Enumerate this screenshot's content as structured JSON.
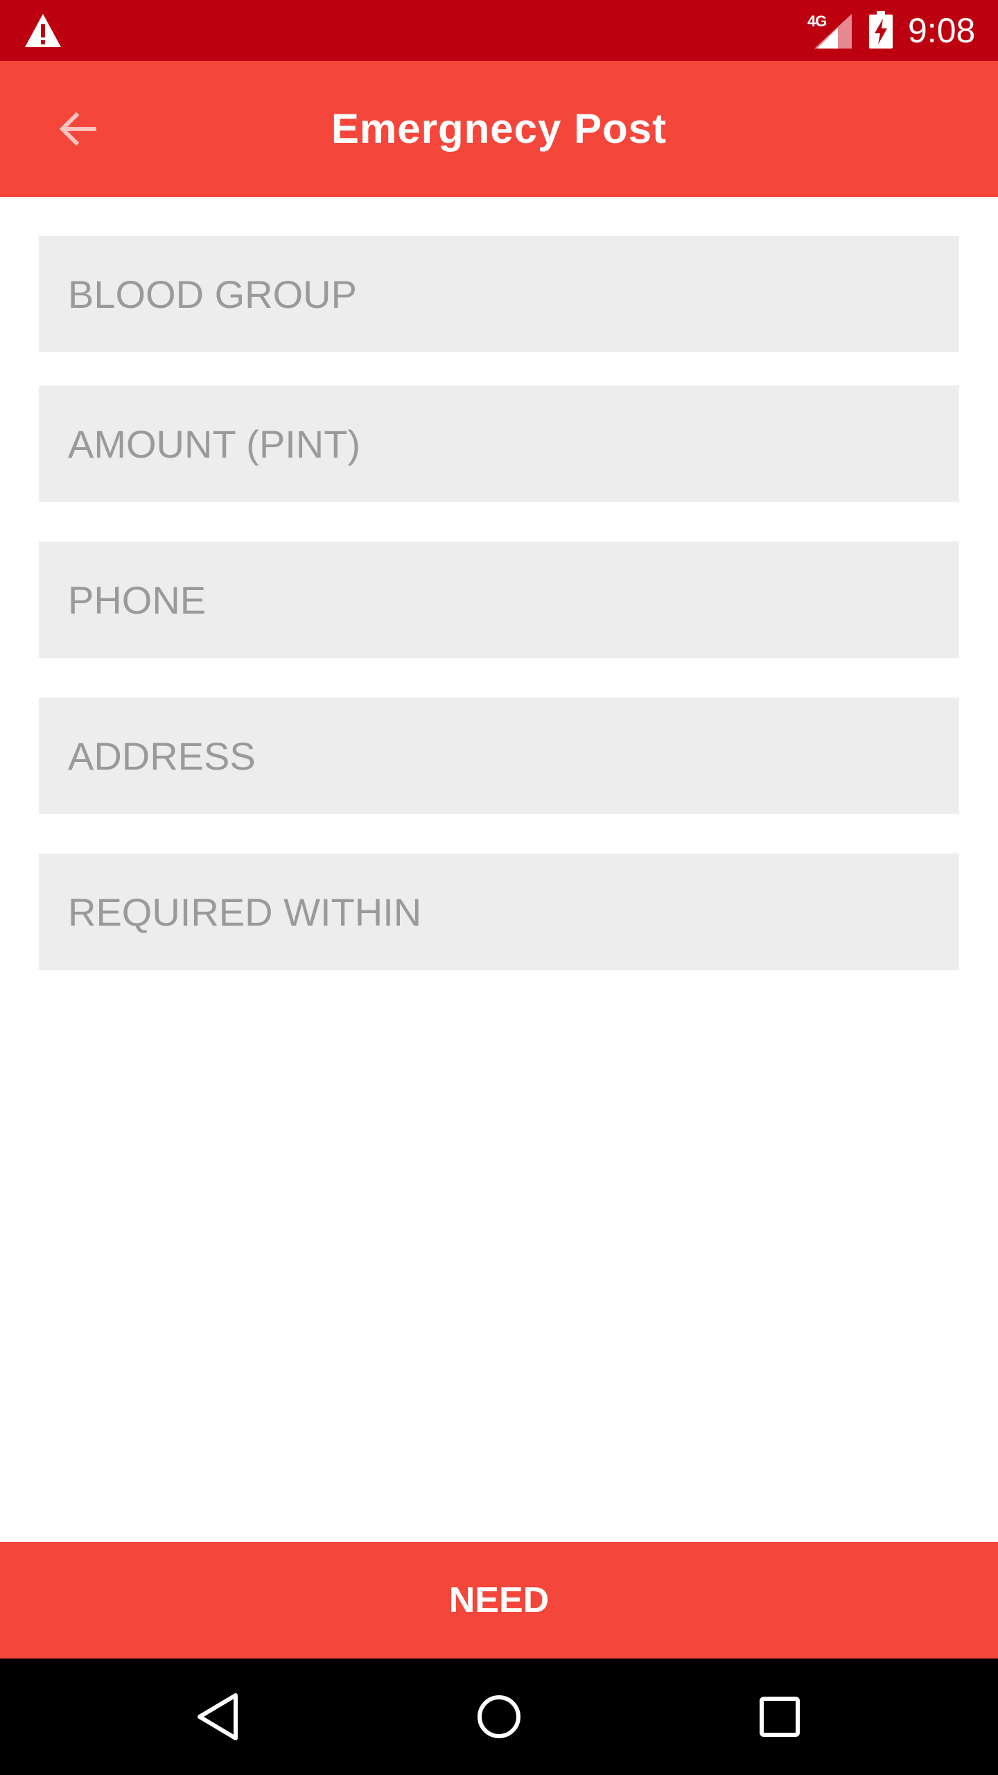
{
  "status_bar": {
    "time": "9:08",
    "network": "4G",
    "icons": [
      "warning-icon",
      "signal-icon",
      "battery-charging-icon"
    ],
    "color": "#bd0010"
  },
  "app_bar": {
    "title": "Emergnecy Post",
    "back_icon": "arrow-back-icon",
    "color": "#f4463a"
  },
  "form": {
    "fields": [
      {
        "placeholder": "BLOOD GROUP",
        "value": ""
      },
      {
        "placeholder": "AMOUNT (PINT)",
        "value": ""
      },
      {
        "placeholder": "PHONE",
        "value": ""
      },
      {
        "placeholder": "ADDRESS",
        "value": ""
      },
      {
        "placeholder": "REQUIRED WITHIN",
        "value": ""
      }
    ],
    "field_background": "#ededed"
  },
  "submit": {
    "label": "NEED",
    "color": "#f4463a"
  },
  "nav_bar": {
    "icons": [
      "nav-back-icon",
      "nav-home-icon",
      "nav-recents-icon"
    ]
  }
}
